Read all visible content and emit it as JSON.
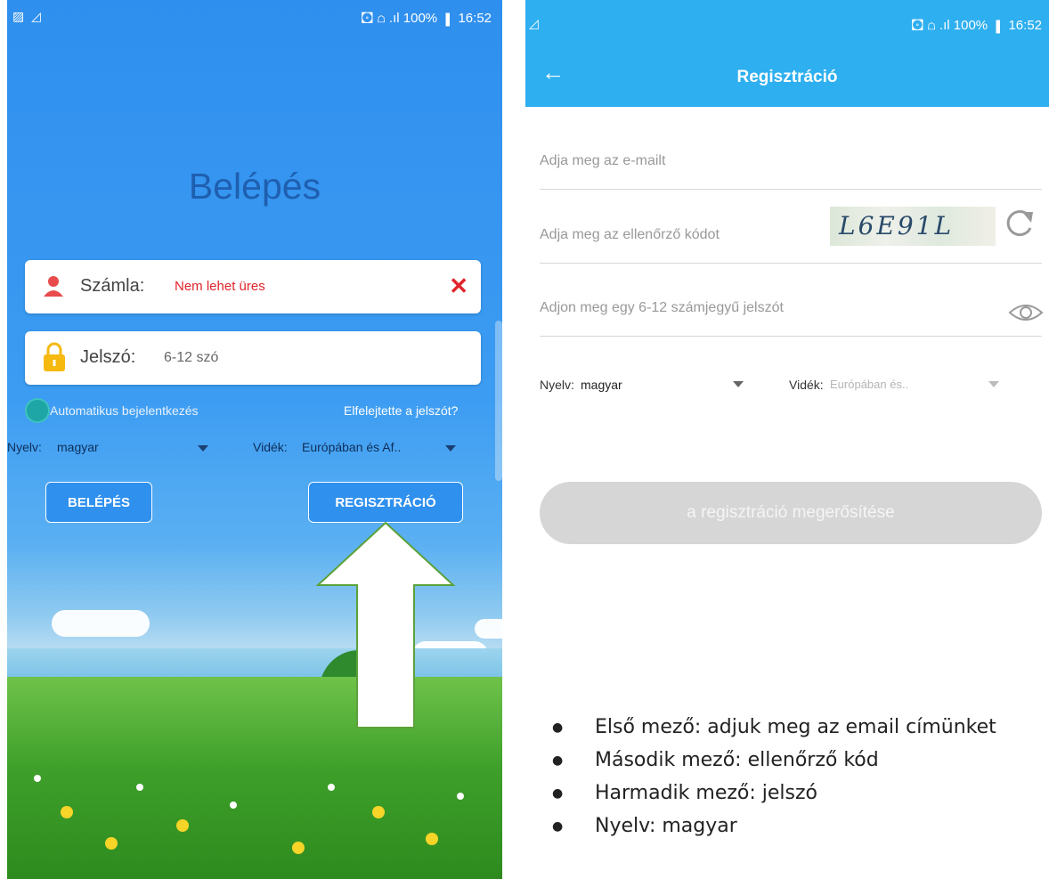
{
  "left": {
    "status": {
      "left": "▨ ◿",
      "right": "🖸 ☖ .ıl 100% ▮ 16:52"
    },
    "title": "Belépés",
    "account": {
      "label": "Számla:",
      "error": "Nem lehet üres"
    },
    "password": {
      "label": "Jelszó:",
      "hint": "6-12 szó"
    },
    "auto_login": "Automatikus bejelentkezés",
    "forgot": "Elfelejtette a jelszót?",
    "language_label": "Nyelv:",
    "language_value": "magyar",
    "region_label": "Vidék:",
    "region_value": "Európában és Af..",
    "login_button": "BELÉPÉS",
    "register_button": "REGISZTRÁCIÓ"
  },
  "right": {
    "status": {
      "left": "◿",
      "right": "🖸 ☖ .ıl 100% ▮ 16:52"
    },
    "title": "Regisztráció",
    "email_placeholder": "Adja meg az e-mailt",
    "code_placeholder": "Adja meg az ellenőrző kódot",
    "captcha": "L6E91L",
    "password_placeholder": "Adjon meg egy 6-12 számjegyű jelszót",
    "language_label": "Nyelv:",
    "language_value": "magyar",
    "region_label": "Vidék:",
    "region_value": "Európában és..",
    "confirm_button": "a regisztráció megerősítése"
  },
  "notes": [
    "Első mező: adjuk meg az email címünket",
    "Második mező: ellenőrző kód",
    "Harmadik mező: jelszó",
    "Nyelv: magyar"
  ],
  "colors": {
    "header_blue": "#2eaff0",
    "error_red": "#e0242b",
    "arrow_border": "#5aa23a"
  }
}
